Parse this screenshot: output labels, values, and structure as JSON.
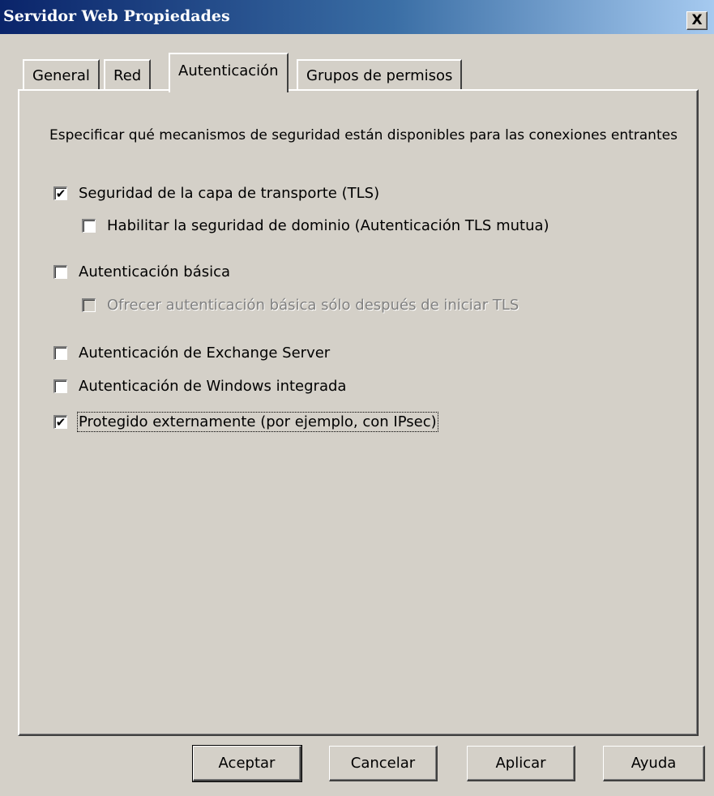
{
  "window": {
    "title": "Servidor Web Propiedades",
    "close_label": "X"
  },
  "tabs": [
    {
      "label": "General",
      "active": false
    },
    {
      "label": "Red",
      "active": false
    },
    {
      "label": "Autenticación",
      "active": true
    },
    {
      "label": "Grupos de permisos",
      "active": false
    }
  ],
  "panel": {
    "description": "Especificar qué mecanismos de seguridad están disponibles para las conexiones entrantes",
    "options": [
      {
        "label": "Seguridad de la capa de transporte (TLS)",
        "checked": true,
        "enabled": true
      },
      {
        "label": "Habilitar la seguridad de dominio (Autenticación TLS mutua)",
        "checked": false,
        "enabled": true
      },
      {
        "label": "Autenticación básica",
        "checked": false,
        "enabled": true
      },
      {
        "label": "Ofrecer autenticación básica sólo después de iniciar TLS",
        "checked": false,
        "enabled": false
      },
      {
        "label": "Autenticación de Exchange Server",
        "checked": false,
        "enabled": true
      },
      {
        "label": "Autenticación de Windows integrada",
        "checked": false,
        "enabled": true
      },
      {
        "label": "Protegido externamente (por ejemplo, con IPsec)",
        "checked": true,
        "enabled": true
      }
    ]
  },
  "buttons": {
    "ok": "Aceptar",
    "cancel": "Cancelar",
    "apply": "Aplicar",
    "help": "Ayuda"
  },
  "check_glyph": "✔"
}
